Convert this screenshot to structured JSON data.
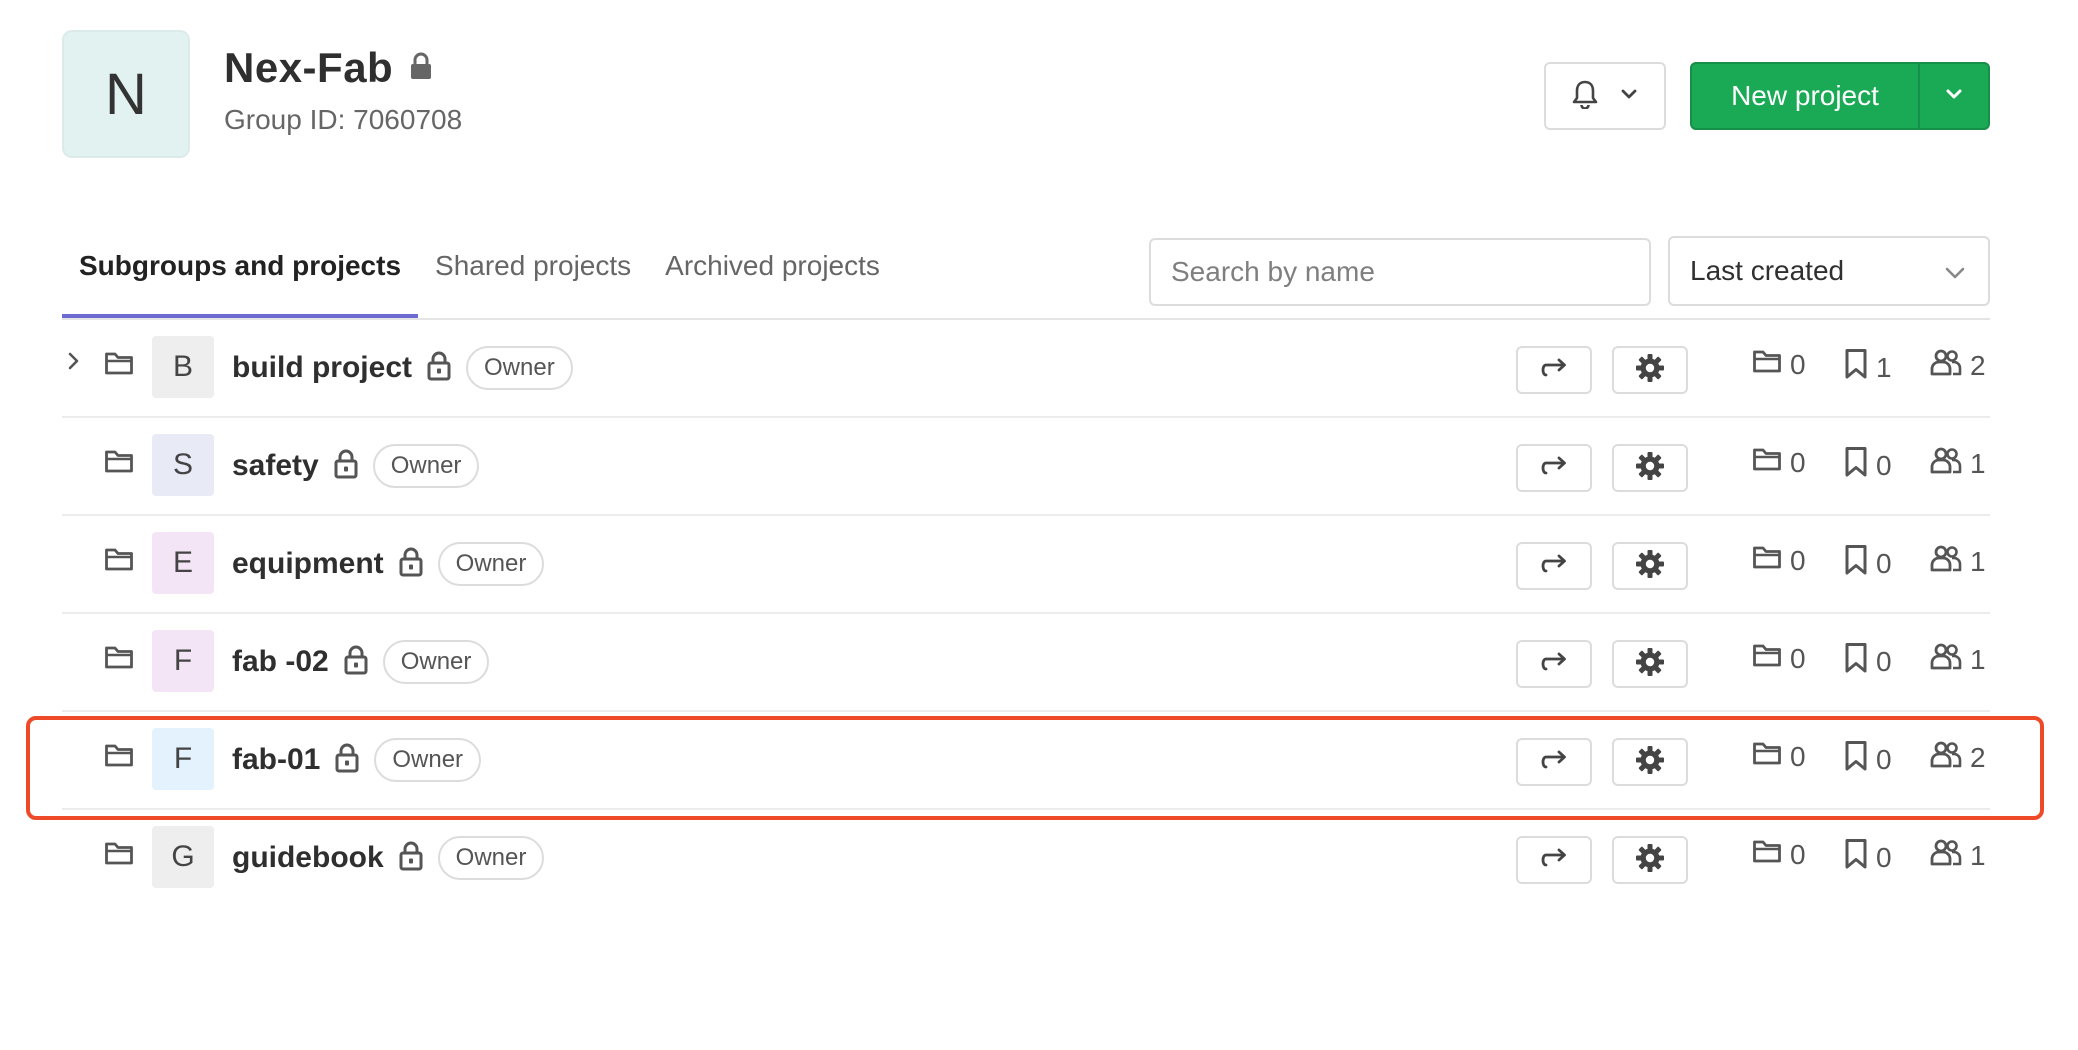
{
  "group": {
    "avatar_letter": "N",
    "name": "Nex-Fab",
    "id_text": "Group ID: 7060708",
    "avatar_color": "#e1f2f0"
  },
  "header": {
    "notification_icon": "bell-icon",
    "new_project_label": "New project",
    "accent_color": "#1aaa55"
  },
  "tabs": [
    {
      "label": "Subgroups and projects",
      "active": true
    },
    {
      "label": "Shared projects",
      "active": false
    },
    {
      "label": "Archived projects",
      "active": false
    }
  ],
  "search": {
    "placeholder": "Search by name",
    "value": ""
  },
  "sort": {
    "selected": "Last created"
  },
  "rows": [
    {
      "letter": "B",
      "name": "build project",
      "badge": "Owner",
      "subgroups": "0",
      "projects": "1",
      "members": "2",
      "avatar_color": "#eeeeee",
      "expandable": true
    },
    {
      "letter": "S",
      "name": "safety",
      "badge": "Owner",
      "subgroups": "0",
      "projects": "0",
      "members": "1",
      "avatar_color": "#e8eaf6",
      "expandable": false
    },
    {
      "letter": "E",
      "name": "equipment",
      "badge": "Owner",
      "subgroups": "0",
      "projects": "0",
      "members": "1",
      "avatar_color": "#f3e5f5",
      "expandable": false
    },
    {
      "letter": "F",
      "name": "fab -02",
      "badge": "Owner",
      "subgroups": "0",
      "projects": "0",
      "members": "1",
      "avatar_color": "#f3e5f5",
      "expandable": false
    },
    {
      "letter": "F",
      "name": "fab-01",
      "badge": "Owner",
      "subgroups": "0",
      "projects": "0",
      "members": "2",
      "avatar_color": "#e3f2fd",
      "expandable": false,
      "highlighted": true
    },
    {
      "letter": "G",
      "name": "guidebook",
      "badge": "Owner",
      "subgroups": "0",
      "projects": "0",
      "members": "1",
      "avatar_color": "#eeeeee",
      "expandable": false
    }
  ],
  "highlight_color": "#ef4a28"
}
